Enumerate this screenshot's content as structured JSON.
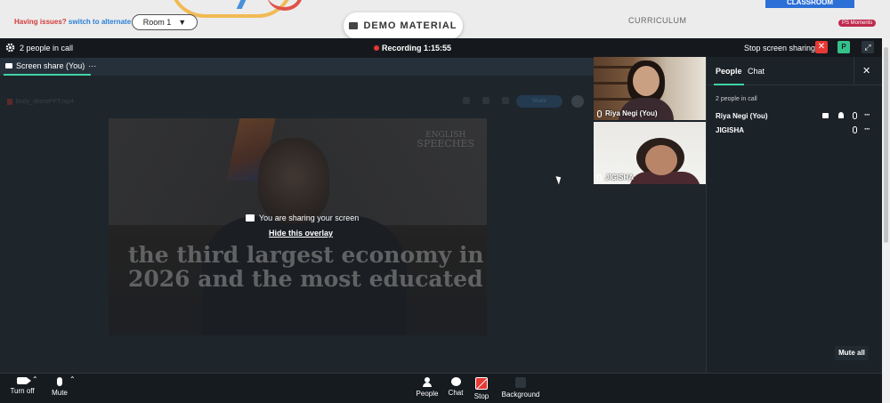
{
  "topbar": {
    "issues_question": "Having issues?",
    "issues_action": "switch to alternate room",
    "room_label": "Room 1",
    "demo_material": "DEMO MATERIAL",
    "curriculum": "CURRICULUM",
    "classroom_tab": "CLASSROOM",
    "moments_badge": "PS Moments"
  },
  "callbar": {
    "people_count": "2 people in call",
    "recording": "Recording 1:15:55",
    "stop_sharing": "Stop screen sharing",
    "avatar_initial": "P"
  },
  "share": {
    "tab_label": "Screen share (You)",
    "tab_more": "···",
    "file_name": "body_demoPPT.mp4",
    "share_button": "Share",
    "overlay_message": "You are sharing your screen",
    "hide_overlay": "Hide this overlay",
    "video_logo_top": "ENGLISH",
    "video_logo_bottom": "SPEECHES",
    "video_caption": "the third largest economy in 2026 and the most educated"
  },
  "tiles": [
    {
      "name": "Riya Negi (You)"
    },
    {
      "name": "JIGISHA"
    }
  ],
  "panel": {
    "tab_people": "People",
    "tab_chat": "Chat",
    "close": "✕",
    "count": "2 people in call",
    "people": [
      {
        "name": "Riya Negi (You)",
        "more": "···"
      },
      {
        "name": "JIGISHA",
        "more": "···"
      }
    ],
    "mute_all": "Mute all"
  },
  "toolbar": {
    "turn_off": "Turn off",
    "mute": "Mute",
    "people": "People",
    "chat": "Chat",
    "stop": "Stop",
    "background": "Background",
    "chevron": "⌃"
  },
  "colors": {
    "accent": "#3fd3a4",
    "danger": "#e53935",
    "panel_bg": "#1b2228"
  }
}
